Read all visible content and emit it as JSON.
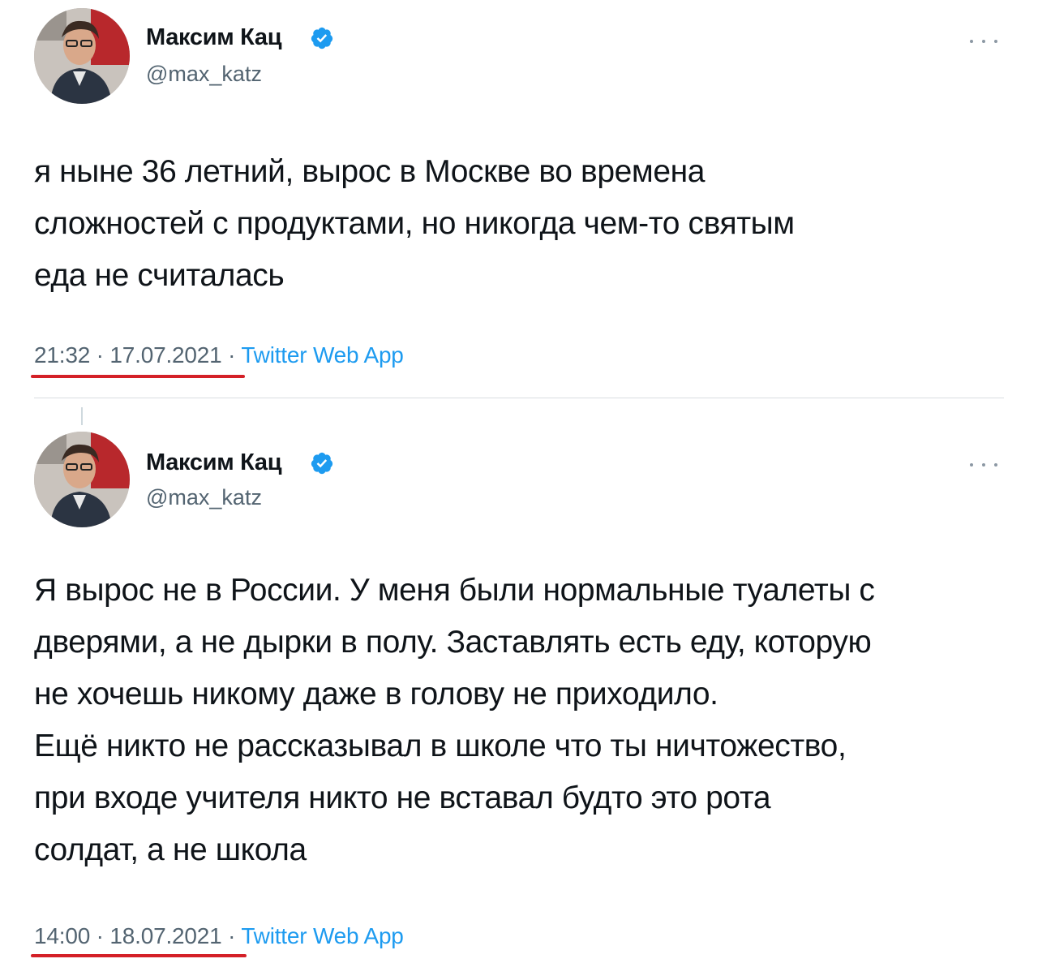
{
  "colors": {
    "text_primary": "#0f1419",
    "text_secondary": "#536471",
    "link_blue": "#1d9bf0",
    "verified_blue": "#1d9bf0",
    "annotation_red": "#d42027",
    "divider": "#d9dde1"
  },
  "tweets": [
    {
      "author": {
        "display_name": "Максим Кац",
        "handle": "@max_katz",
        "verified_icon": "verified-badge-icon",
        "avatar_icon": "profile-photo"
      },
      "more_icon": "more-options-icon",
      "text_lines": [
        "я ныне 36 летний, вырос в Москве во времена",
        "сложностей с продуктами, но никогда чем-то святым",
        "еда не считалась"
      ],
      "time": "21:32",
      "separator": "·",
      "date": "17.07.2021",
      "source": "Twitter Web App"
    },
    {
      "author": {
        "display_name": "Максим Кац",
        "handle": "@max_katz",
        "verified_icon": "verified-badge-icon",
        "avatar_icon": "profile-photo"
      },
      "more_icon": "more-options-icon",
      "text_lines": [
        "Я вырос не в России. У меня были нормальные туалеты с",
        "дверями, а не дырки в полу. Заставлять есть еду, которую",
        "не хочешь никому даже в голову не приходило.",
        "Ещё никто не рассказывал в школе что ты ничтожество,",
        "при входе учителя никто не вставал будто это рота",
        "солдат, а не школа"
      ],
      "time": "14:00",
      "separator": "·",
      "date": "18.07.2021",
      "source": "Twitter Web App"
    }
  ]
}
